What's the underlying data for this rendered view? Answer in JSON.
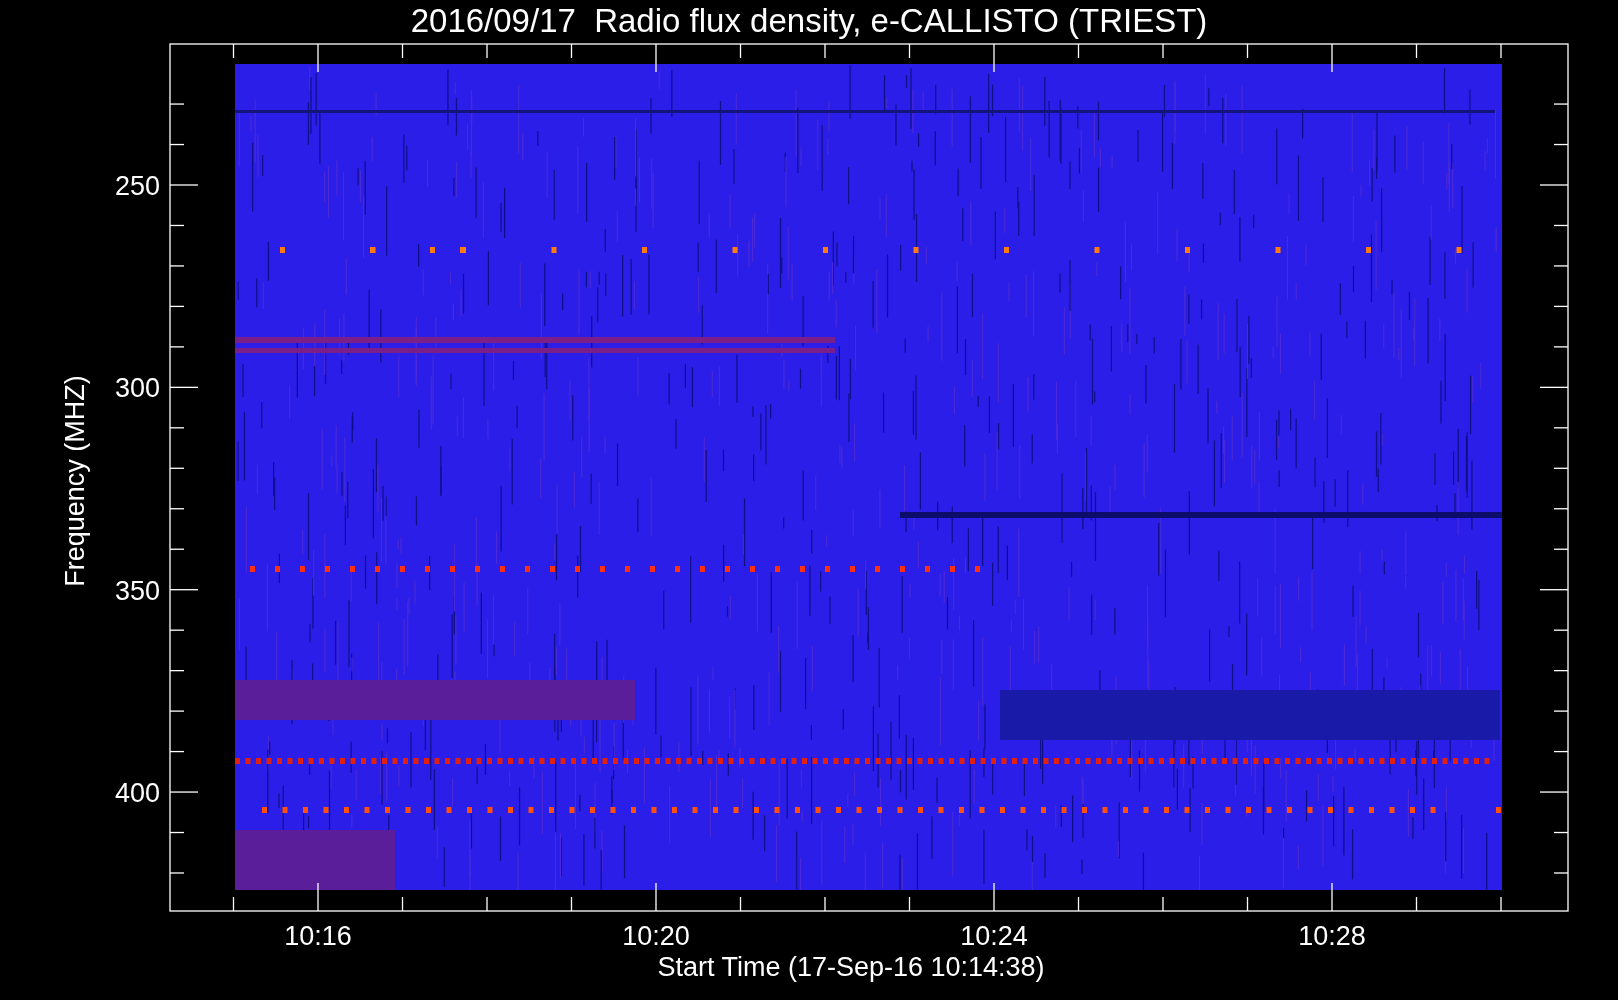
{
  "title": "2016/09/17  Radio flux density, e-CALLISTO (TRIEST)",
  "xlabel": "Start Time (17-Sep-16 10:14:38)",
  "ylabel": "Frequency (MHZ)",
  "yticks": [
    "250",
    "300",
    "350",
    "400"
  ],
  "xticks": [
    "10:16",
    "10:20",
    "10:24",
    "10:28"
  ]
}
